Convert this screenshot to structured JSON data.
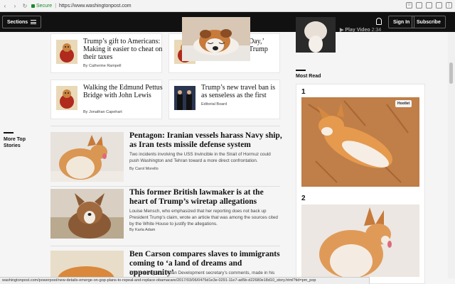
{
  "browser": {
    "secure_label": "Secure",
    "url": "https://www.washingtonpost.com",
    "status_url": "washingtonpost.com/powerpost/new-details-emerge-on-gop-plans-to-repeal-and-replace-obamacare/2017/03/06/0475d1e3e-0291-11e7-ad5b-d22680e18d10_story.html?tid=pm_pop"
  },
  "header": {
    "sections_label": "Sections",
    "signin_label": "Sign In",
    "subscribe_label": "Subscribe"
  },
  "cards": [
    {
      "headline": "Trump’s gift to Americans: Making it easier to cheat on their taxes",
      "byline": "By Catherine Rampell"
    },
    {
      "headline_partial_1": "Day,’",
      "headline_partial_2": "Trump"
    },
    {
      "headline": "Walking the Edmund Pettus Bridge with John Lewis",
      "byline": "By Jonathan Capehart"
    },
    {
      "headline": "Trump’s new travel ban is as senseless as the first",
      "byline": "Editorial Board"
    }
  ],
  "more_top_stories": "More Top Stories",
  "stories": [
    {
      "headline": "Pentagon: Iranian vessels harass Navy ship, as Iran tests missile defense system",
      "summary": "Two incidents involving the USS Invincible in the Strait of Hormuz could push Washington and Tehran toward a more direct confrontation.",
      "byline": "By Carol Morello"
    },
    {
      "headline": "This former British lawmaker is at the heart of Trump’s wiretap allegations",
      "summary": "Louise Mensch, who emphasized that her reporting does not back up President Trump’s claim, wrote an article that was among the sources cited by the White House to justify the allegations.",
      "byline": "By Karla Adam"
    },
    {
      "headline": "Ben Carson compares slaves to immigrants coming to ‘a land of dreams and opportunity’",
      "summary": "The Housing and Urban Development secretary’s comments, made in his"
    }
  ],
  "right_column": {
    "play_video": "Play Video",
    "video_time": "2:34",
    "most_read": "Most Read",
    "items": [
      {
        "number": "1"
      },
      {
        "number": "2"
      }
    ],
    "hootlet_label": "Hootlet"
  }
}
